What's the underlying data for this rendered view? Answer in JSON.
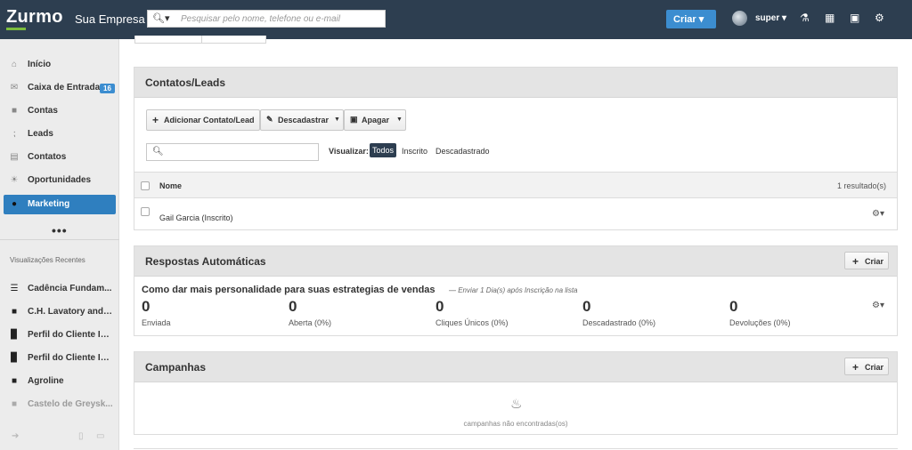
{
  "header": {
    "logo": "Zurmo",
    "company": "Sua Empresa",
    "search_placeholder": "Pesquisar pelo nome, telefone ou e-mail",
    "search_icon": "search-icon",
    "create_label": "Criar ▾",
    "username": "super ▾",
    "icons": [
      "activity-icon",
      "calendar-icon",
      "box-icon",
      "gear-icon"
    ]
  },
  "sidebar": {
    "items": [
      {
        "label": "Início",
        "icon": "home-icon"
      },
      {
        "label": "Caixa de Entrada",
        "icon": "envelope-icon",
        "badge": "16"
      },
      {
        "label": "Contas",
        "icon": "folder-icon"
      },
      {
        "label": "Leads",
        "icon": "sprout-icon"
      },
      {
        "label": "Contatos",
        "icon": "contact-card-icon"
      },
      {
        "label": "Oportunidades",
        "icon": "lightbulb-icon"
      },
      {
        "label": "Marketing",
        "icon": "marketing-icon",
        "active": true
      }
    ],
    "more": "•••",
    "recent_title": "Visualizações Recentes",
    "recent": [
      {
        "label": "Cadência Fundam...",
        "icon": "list-icon"
      },
      {
        "label": "C.H. Lavatory and ...",
        "icon": "folder-icon"
      },
      {
        "label": "Perfil do Cliente Id...",
        "icon": "bar-chart-icon"
      },
      {
        "label": "Perfil do Cliente Id...",
        "icon": "bar-chart-icon"
      },
      {
        "label": "Agroline",
        "icon": "folder-icon"
      },
      {
        "label": "Castelo de Greysk...",
        "icon": "folder-icon"
      }
    ]
  },
  "contacts_panel": {
    "title": "Contatos/Leads",
    "add_button": "Adicionar Contato/Lead",
    "unsubscribe_button": "Descadastrar",
    "delete_button": "Apagar",
    "visualize_label": "Visualizar:",
    "filters": [
      "Todos",
      "Inscrito",
      "Descadastrado"
    ],
    "active_filter": "Todos",
    "column_name": "Nome",
    "results": "1 resultado(s)",
    "rows": [
      {
        "name": "Gail Garcia (Inscrito)"
      }
    ]
  },
  "autoresponders_panel": {
    "title": "Respostas Automáticas",
    "create_label": "Criar",
    "item_title": "Como dar mais personalidade para suas estrategias de vendas",
    "item_subtitle": "— Enviar 1 Dia(s) após Inscrição na lista",
    "stats": [
      {
        "value": "0",
        "label": "Enviada"
      },
      {
        "value": "0",
        "label": "Aberta (0%)"
      },
      {
        "value": "0",
        "label": "Cliques Únicos (0%)"
      },
      {
        "value": "0",
        "label": "Descadastrado (0%)"
      },
      {
        "value": "0",
        "label": "Devoluções (0%)"
      }
    ]
  },
  "campaigns_panel": {
    "title": "Campanhas",
    "create_label": "Criar",
    "empty_text": "campanhas não encontradas(os)",
    "empty_icon": "flame-icon"
  },
  "colors": {
    "topbar": "#2d3e50",
    "accent": "#3c8dd0",
    "active_nav": "#2f7fbf",
    "logo_green": "#7cbd3c"
  }
}
